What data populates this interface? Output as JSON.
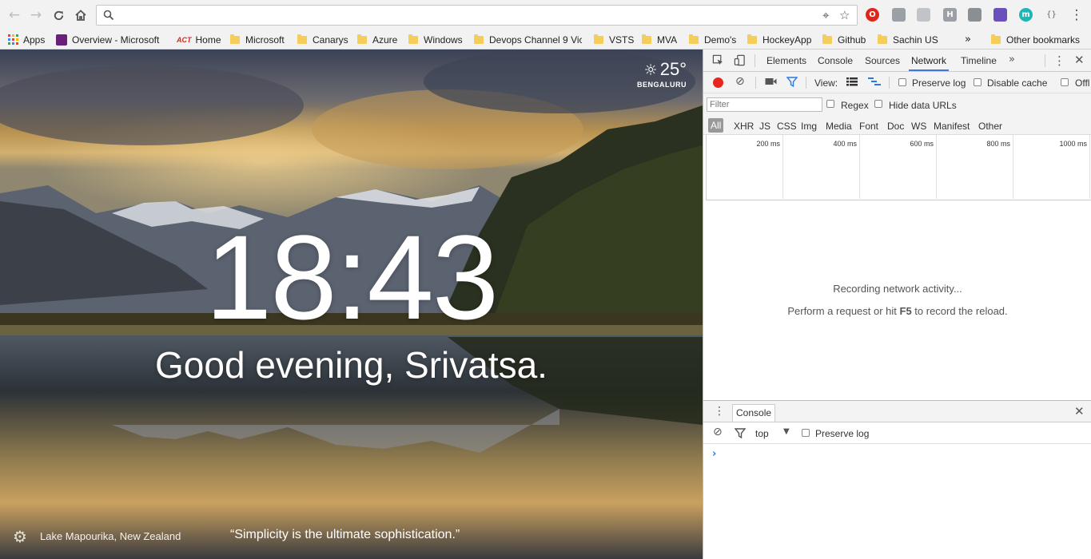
{
  "browser": {
    "url": "",
    "bookmarks": [
      {
        "label": "Apps",
        "icon": "apps-grid-icon"
      },
      {
        "label": "Overview - Microsoft",
        "icon": "visual-studio-icon"
      },
      {
        "label": "Home",
        "icon": "act-logo-icon"
      },
      {
        "label": "Microsoft",
        "icon": "folder-icon"
      },
      {
        "label": "Canarys",
        "icon": "folder-icon"
      },
      {
        "label": "Azure",
        "icon": "folder-icon"
      },
      {
        "label": "Windows",
        "icon": "folder-icon"
      },
      {
        "label": "Devops Channel 9 Vic",
        "icon": "folder-icon"
      },
      {
        "label": "VSTS",
        "icon": "folder-icon"
      },
      {
        "label": "MVA",
        "icon": "folder-icon"
      },
      {
        "label": "Demo's",
        "icon": "folder-icon"
      },
      {
        "label": "HockeyApp",
        "icon": "folder-icon"
      },
      {
        "label": "Github",
        "icon": "folder-icon"
      },
      {
        "label": "Sachin US",
        "icon": "folder-icon"
      },
      {
        "label": "Other bookmarks",
        "icon": "folder-icon"
      }
    ],
    "extensions": [
      {
        "name": "opera-icon",
        "text": "O",
        "color": "#e0251b"
      },
      {
        "name": "shield-icon",
        "text": "",
        "color": "#9aa0a6"
      },
      {
        "name": "puzzle-icon",
        "text": "",
        "color": "#c0c4c8"
      },
      {
        "name": "h-extension-icon",
        "text": "H",
        "color": "#9aa0a6"
      },
      {
        "name": "tag-icon",
        "text": "",
        "color": "#8a8f94"
      },
      {
        "name": "flask-icon",
        "text": "",
        "color": "#6b4fbb"
      },
      {
        "name": "m-extension-icon",
        "text": "m",
        "color": "#1fb6b6"
      },
      {
        "name": "json-braces-icon",
        "text": "{}",
        "color": "#9aa0a6"
      }
    ]
  },
  "momentum": {
    "temperature": "25°",
    "city": "BENGALURU",
    "time": "18:43",
    "greeting": "Good evening, Srivatsa.",
    "location": "Lake Mapourika, New Zealand",
    "quote": "“Simplicity is the ultimate sophistication.”"
  },
  "devtools": {
    "tabs": [
      "Elements",
      "Console",
      "Sources",
      "Network",
      "Timeline"
    ],
    "active_tab": "Network",
    "view_label": "View:",
    "preserve_log": "Preserve log",
    "disable_cache": "Disable cache",
    "offline": "Offl",
    "filter_placeholder": "Filter",
    "regex": "Regex",
    "hide_data_urls": "Hide data URLs",
    "filter_types": [
      "All",
      "XHR",
      "JS",
      "CSS",
      "Img",
      "Media",
      "Font",
      "Doc",
      "WS",
      "Manifest",
      "Other"
    ],
    "timeline_ticks": [
      "200 ms",
      "400 ms",
      "600 ms",
      "800 ms",
      "1000 ms"
    ],
    "empty_line1": "Recording network activity...",
    "empty_line2_pre": "Perform a request or hit ",
    "empty_line2_key": "F5",
    "empty_line2_post": " to record the reload.",
    "drawer_tab": "Console",
    "console_context": "top",
    "console_preserve_log": "Preserve log",
    "console_prompt": "›"
  }
}
